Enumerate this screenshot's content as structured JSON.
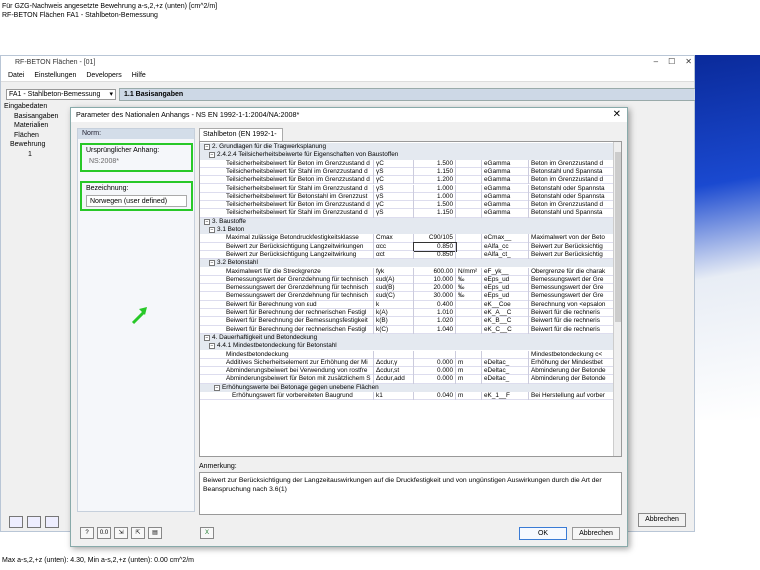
{
  "top_lines": [
    "Für GZG-Nachweis angesetzte Bewehrung a-s,2,+z (unten) [cm^2/m]",
    "RF-BETON Flächen FA1 - Stahlbeton-Bemessung"
  ],
  "bottom_line": "Max a-s,2,+z (unten): 4.30, Min a-s,2,+z (unten): 0.00 cm^2/m",
  "bg": {
    "title": "RF-BETON Flächen - [01]",
    "menu": [
      "Datei",
      "Einstellungen",
      "Developers",
      "Hilfe"
    ],
    "combo": "FA1 - Stahlbeton-Bemessung",
    "tab": "1.1 Basisangaben",
    "tree": [
      "Eingabedaten",
      "Basisangaben",
      "Materialien",
      "Flächen",
      "Bewehrung",
      "1"
    ],
    "cancel": "Abbrechen"
  },
  "dlg": {
    "title": "Parameter des Nationalen Anhangs - NS EN 1992-1-1:2004/NA:2008*",
    "norm_header": "Norm:",
    "orig_label": "Ursprünglicher Anhang:",
    "orig_value": "NS:2008*",
    "name_label": "Bezeichnung:",
    "name_value": "Norwegen (user defined)",
    "tab": "Stahlbeton (EN 1992-1-1)",
    "note_label": "Anmerkung:",
    "note_text": "Beiwert zur Berücksichtigung der Langzeitauswirkungen auf die Druckfestigkeit und von ungünstigen Auswirkungen durch die Art der Beanspruchung nach 3.6(1)",
    "ok": "OK",
    "cancel": "Abbrechen"
  },
  "rows": [
    {
      "t": "s",
      "lvl": 0,
      "name": "2. Grundlagen für die Tragwerksplanung"
    },
    {
      "t": "s",
      "lvl": 1,
      "name": "2.4.2.4 Teilsicherheitsbeiwerte für Eigenschaften von Baustoffen"
    },
    {
      "t": "p",
      "name": "Teilsicherheitsbeiwert für Beton im Grenzzustand d",
      "sym": "γC",
      "val": "1.500",
      "unit": "",
      "id": "eGamma",
      "desc": "Beton im Grenzzustand d"
    },
    {
      "t": "p",
      "name": "Teilsicherheitsbeiwert für Stahl im Grenzzustand d",
      "sym": "γS",
      "val": "1.150",
      "unit": "",
      "id": "eGamma",
      "desc": "Betonstahl und Spannsta"
    },
    {
      "t": "p",
      "name": "Teilsicherheitsbeiwert für Beton im Grenzzustand d",
      "sym": "γC",
      "val": "1.200",
      "unit": "",
      "id": "eGamma",
      "desc": "Beton im Grenzzustand d"
    },
    {
      "t": "p",
      "name": "Teilsicherheitsbeiwert für Stahl im Grenzzustand d",
      "sym": "γS",
      "val": "1.000",
      "unit": "",
      "id": "eGamma",
      "desc": "Betonstahl oder Spannsta"
    },
    {
      "t": "p",
      "name": "Teilsicherheitsbeiwert für Betonstahl im Grenzzust",
      "sym": "γS",
      "val": "1.000",
      "unit": "",
      "id": "eGamma",
      "desc": "Betonstahl oder Spannsta"
    },
    {
      "t": "p",
      "name": "Teilsicherheitsbeiwert für Beton im Grenzzustand d",
      "sym": "γC",
      "val": "1.500",
      "unit": "",
      "id": "eGamma",
      "desc": "Beton im Grenzzustand d"
    },
    {
      "t": "p",
      "name": "Teilsicherheitsbeiwert für Stahl im Grenzzustand d",
      "sym": "γS",
      "val": "1.150",
      "unit": "",
      "id": "eGamma",
      "desc": "Betonstahl und Spannsta"
    },
    {
      "t": "s",
      "lvl": 0,
      "name": "3. Baustoffe"
    },
    {
      "t": "s",
      "lvl": 1,
      "name": "3.1 Beton"
    },
    {
      "t": "p",
      "name": "Maximal zulässige Betondruckfestigkeitsklasse",
      "sym": "Cmax",
      "val": "C90/105",
      "unit": "",
      "id": "eCmax__",
      "desc": "Maximalwert von der Beto"
    },
    {
      "t": "p",
      "name": "Beiwert zur Berücksichtigung Langzeitwirkungen",
      "sym": "αcc",
      "val": "0.850",
      "unit": "",
      "id": "eAlfa_cc",
      "desc": "Beiwert zur Berücksichtig",
      "sel": true
    },
    {
      "t": "p",
      "name": "Beiwert zur Berücksichtigung Langzeitwirkung",
      "sym": "αct",
      "val": "0.850",
      "unit": "",
      "id": "eAlfa_ct_",
      "desc": "Beiwert zur Berücksichtig"
    },
    {
      "t": "s",
      "lvl": 1,
      "name": "3.2 Betonstahl"
    },
    {
      "t": "p",
      "name": "Maximalwert für die Streckgrenze",
      "sym": "fyk",
      "val": "600.00",
      "unit": "N/mm²",
      "id": "eF_yk__",
      "desc": "Obergrenze für die charak"
    },
    {
      "t": "p",
      "name": "Bemessungswert der Grenzdehnung für technisch",
      "sym": "εud(A)",
      "val": "10.000",
      "unit": "‰",
      "id": "eEps_ud",
      "desc": "Bemessungswert der Gre"
    },
    {
      "t": "p",
      "name": "Bemessungswert der Grenzdehnung für technisch",
      "sym": "εud(B)",
      "val": "20.000",
      "unit": "‰",
      "id": "eEps_ud",
      "desc": "Bemessungswert der Gre"
    },
    {
      "t": "p",
      "name": "Bemessungswert der Grenzdehnung für technisch",
      "sym": "εud(C)",
      "val": "30.000",
      "unit": "‰",
      "id": "eEps_ud",
      "desc": "Bemessungswert der Gre"
    },
    {
      "t": "p",
      "name": "Beiwert für Berechnung von εud",
      "sym": "k",
      "val": "0.400",
      "unit": "",
      "id": "eK__Coe",
      "desc": "Berechnung von <epsalon"
    },
    {
      "t": "p",
      "name": "Beiwert für Berechnung der rechnerischen Festigl",
      "sym": "k(A)",
      "val": "1.010",
      "unit": "",
      "id": "eK_A__C",
      "desc": "Beiwert für die rechneris"
    },
    {
      "t": "p",
      "name": "Beiwert für Berechnung der Bemessungsfestigkeit",
      "sym": "k(B)",
      "val": "1.020",
      "unit": "",
      "id": "eK_B__C",
      "desc": "Beiwert für die rechneris"
    },
    {
      "t": "p",
      "name": "Beiwert für Berechnung der rechnerischen Festigl",
      "sym": "k(C)",
      "val": "1.040",
      "unit": "",
      "id": "eK_C__C",
      "desc": "Beiwert für die rechneris"
    },
    {
      "t": "s",
      "lvl": 0,
      "name": "4. Dauerhaftigkeit und Betondeckung"
    },
    {
      "t": "s",
      "lvl": 1,
      "name": "4.4.1 Mindestbetondeckung für Betonstahl"
    },
    {
      "t": "p",
      "name": "Mindestbetondeckung",
      "sym": "",
      "val": "",
      "unit": "",
      "id": "",
      "desc": "Mindestbetondeckung c<"
    },
    {
      "t": "p",
      "name": "Additives Sicherheitselement zur Erhöhung der Mi",
      "sym": "Δcdur,γ",
      "val": "0.000",
      "unit": "m",
      "id": "eDeltac_",
      "desc": "Erhöhung der Mindestbet"
    },
    {
      "t": "p",
      "name": "Abminderungsbeiwert bei Verwendung von rostfre",
      "sym": "Δcdur,st",
      "val": "0.000",
      "unit": "m",
      "id": "eDeltac_",
      "desc": "Abminderung der Betonde"
    },
    {
      "t": "p",
      "name": "Abminderungsbeiwert für Beton mit zusätzlichem S",
      "sym": "Δcdur,add",
      "val": "0.000",
      "unit": "m",
      "id": "eDeltac_",
      "desc": "Abminderung der Betonde"
    },
    {
      "t": "s",
      "lvl": 2,
      "name": "Erhöhungswerte bei Betonage gegen unebene Flächen"
    },
    {
      "t": "p",
      "ind": 1,
      "name": "Erhöhungswert für vorbereiteten Baugrund",
      "sym": "k1",
      "val": "0.040",
      "unit": "m",
      "id": "eK_1__F",
      "desc": "Bei Herstellung auf vorber"
    }
  ]
}
